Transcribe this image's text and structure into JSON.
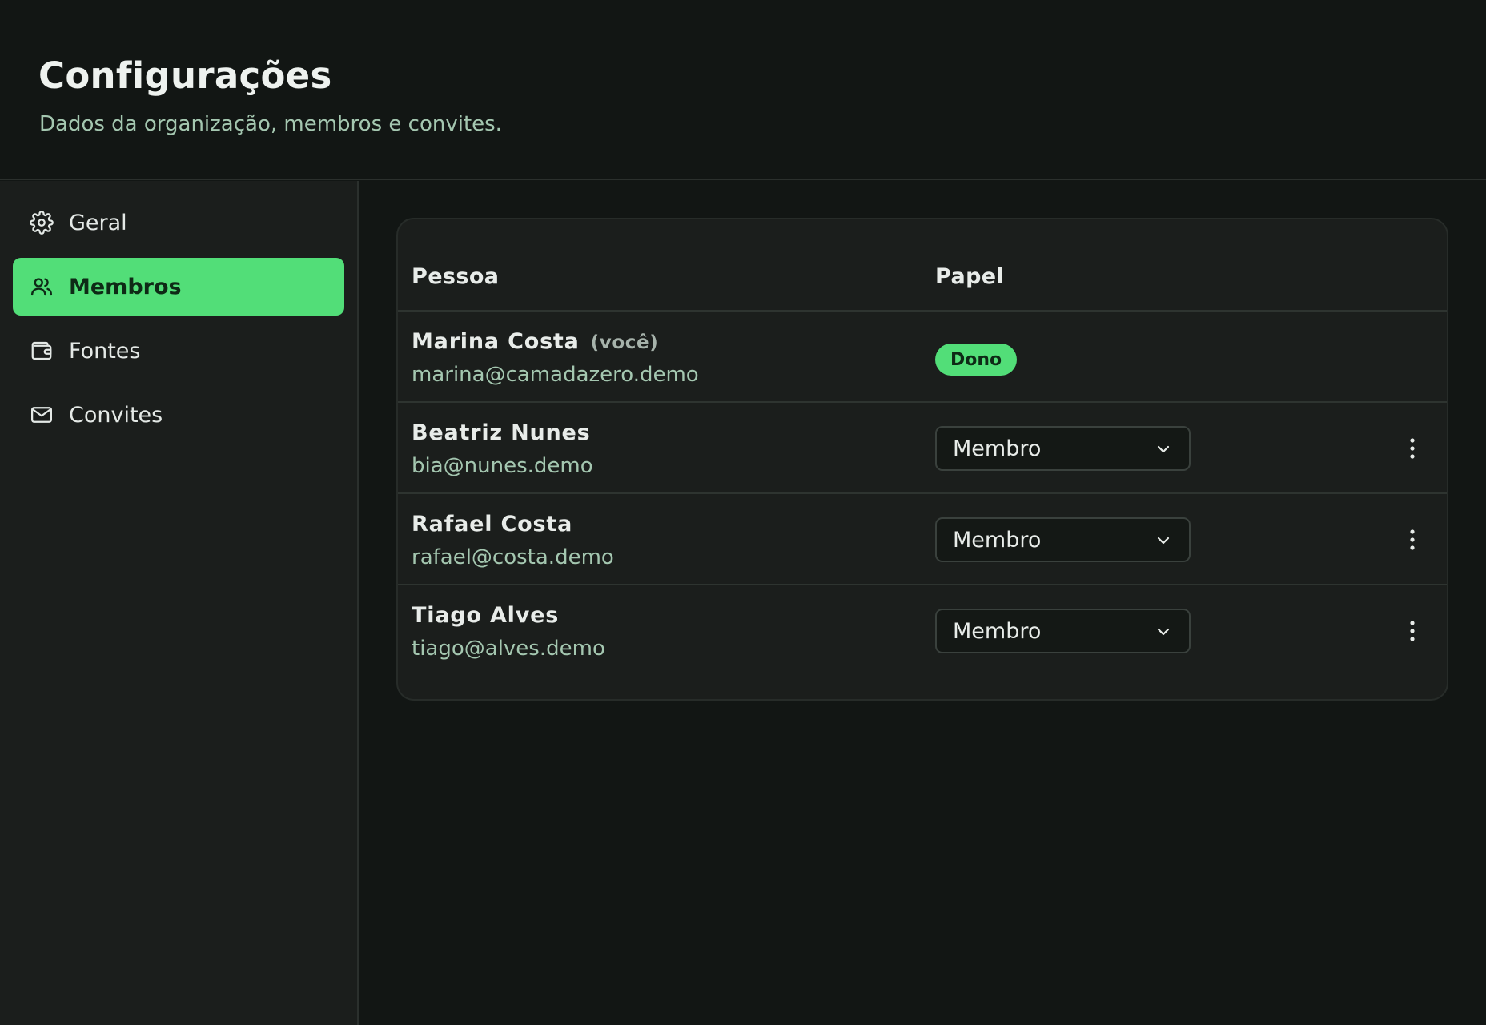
{
  "header": {
    "title": "Configurações",
    "subtitle": "Dados da organização, membros e convites."
  },
  "sidebar": {
    "items": [
      {
        "label": "Geral",
        "icon": "gear-icon"
      },
      {
        "label": "Membros",
        "icon": "users-icon",
        "active": true
      },
      {
        "label": "Fontes",
        "icon": "wallet-icon"
      },
      {
        "label": "Convites",
        "icon": "mail-icon"
      }
    ]
  },
  "members_table": {
    "columns": [
      "Pessoa",
      "Papel"
    ],
    "rows": [
      {
        "name": "Marina Costa",
        "you_tag": "(você)",
        "email": "marina@camadazero.demo",
        "role": "Dono"
      },
      {
        "name": "Beatriz Nunes",
        "email": "bia@nunes.demo",
        "role": "Membro"
      },
      {
        "name": "Rafael Costa",
        "email": "rafael@costa.demo",
        "role": "Membro"
      },
      {
        "name": "Tiago Alves",
        "email": "tiago@alves.demo",
        "role": "Membro"
      }
    ]
  },
  "colors": {
    "accent": "#52de78",
    "background": "#121614",
    "surface": "#1b1e1c",
    "muted_text": "#a4c7b0"
  }
}
